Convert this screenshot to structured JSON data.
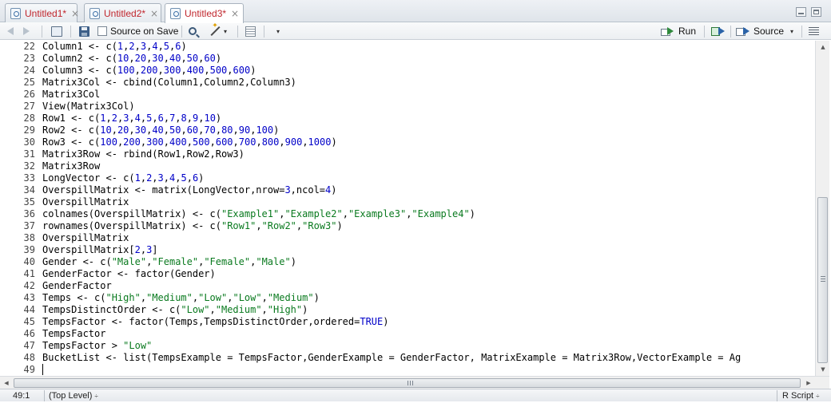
{
  "tabs": [
    {
      "label": "Untitled1*",
      "close": "×",
      "active": false
    },
    {
      "label": "Untitled2*",
      "close": "×",
      "active": false
    },
    {
      "label": "Untitled3*",
      "close": "×",
      "active": true
    }
  ],
  "toolbar": {
    "source_on_save": "Source on Save",
    "run_label": "Run",
    "source_label": "Source",
    "dropdown_glyph": "▾"
  },
  "editor": {
    "lines": [
      {
        "num": "22",
        "tokens": [
          [
            "k",
            "Column1 <- c("
          ],
          [
            "n",
            "1"
          ],
          [
            "k",
            ","
          ],
          [
            "n",
            "2"
          ],
          [
            "k",
            ","
          ],
          [
            "n",
            "3"
          ],
          [
            "k",
            ","
          ],
          [
            "n",
            "4"
          ],
          [
            "k",
            ","
          ],
          [
            "n",
            "5"
          ],
          [
            "k",
            ","
          ],
          [
            "n",
            "6"
          ],
          [
            "k",
            ")"
          ]
        ]
      },
      {
        "num": "23",
        "tokens": [
          [
            "k",
            "Column2 <- c("
          ],
          [
            "n",
            "10"
          ],
          [
            "k",
            ","
          ],
          [
            "n",
            "20"
          ],
          [
            "k",
            ","
          ],
          [
            "n",
            "30"
          ],
          [
            "k",
            ","
          ],
          [
            "n",
            "40"
          ],
          [
            "k",
            ","
          ],
          [
            "n",
            "50"
          ],
          [
            "k",
            ","
          ],
          [
            "n",
            "60"
          ],
          [
            "k",
            ")"
          ]
        ]
      },
      {
        "num": "24",
        "tokens": [
          [
            "k",
            "Column3 <- c("
          ],
          [
            "n",
            "100"
          ],
          [
            "k",
            ","
          ],
          [
            "n",
            "200"
          ],
          [
            "k",
            ","
          ],
          [
            "n",
            "300"
          ],
          [
            "k",
            ","
          ],
          [
            "n",
            "400"
          ],
          [
            "k",
            ","
          ],
          [
            "n",
            "500"
          ],
          [
            "k",
            ","
          ],
          [
            "n",
            "600"
          ],
          [
            "k",
            ")"
          ]
        ]
      },
      {
        "num": "25",
        "tokens": [
          [
            "k",
            "Matrix3Col <- cbind(Column1,Column2,Column3)"
          ]
        ]
      },
      {
        "num": "26",
        "tokens": [
          [
            "k",
            "Matrix3Col"
          ]
        ]
      },
      {
        "num": "27",
        "tokens": [
          [
            "k",
            "View(Matrix3Col)"
          ]
        ]
      },
      {
        "num": "28",
        "tokens": [
          [
            "k",
            "Row1 <- c("
          ],
          [
            "n",
            "1"
          ],
          [
            "k",
            ","
          ],
          [
            "n",
            "2"
          ],
          [
            "k",
            ","
          ],
          [
            "n",
            "3"
          ],
          [
            "k",
            ","
          ],
          [
            "n",
            "4"
          ],
          [
            "k",
            ","
          ],
          [
            "n",
            "5"
          ],
          [
            "k",
            ","
          ],
          [
            "n",
            "6"
          ],
          [
            "k",
            ","
          ],
          [
            "n",
            "7"
          ],
          [
            "k",
            ","
          ],
          [
            "n",
            "8"
          ],
          [
            "k",
            ","
          ],
          [
            "n",
            "9"
          ],
          [
            "k",
            ","
          ],
          [
            "n",
            "10"
          ],
          [
            "k",
            ")"
          ]
        ]
      },
      {
        "num": "29",
        "tokens": [
          [
            "k",
            "Row2 <- c("
          ],
          [
            "n",
            "10"
          ],
          [
            "k",
            ","
          ],
          [
            "n",
            "20"
          ],
          [
            "k",
            ","
          ],
          [
            "n",
            "30"
          ],
          [
            "k",
            ","
          ],
          [
            "n",
            "40"
          ],
          [
            "k",
            ","
          ],
          [
            "n",
            "50"
          ],
          [
            "k",
            ","
          ],
          [
            "n",
            "60"
          ],
          [
            "k",
            ","
          ],
          [
            "n",
            "70"
          ],
          [
            "k",
            ","
          ],
          [
            "n",
            "80"
          ],
          [
            "k",
            ","
          ],
          [
            "n",
            "90"
          ],
          [
            "k",
            ","
          ],
          [
            "n",
            "100"
          ],
          [
            "k",
            ")"
          ]
        ]
      },
      {
        "num": "30",
        "tokens": [
          [
            "k",
            "Row3 <- c("
          ],
          [
            "n",
            "100"
          ],
          [
            "k",
            ","
          ],
          [
            "n",
            "200"
          ],
          [
            "k",
            ","
          ],
          [
            "n",
            "300"
          ],
          [
            "k",
            ","
          ],
          [
            "n",
            "400"
          ],
          [
            "k",
            ","
          ],
          [
            "n",
            "500"
          ],
          [
            "k",
            ","
          ],
          [
            "n",
            "600"
          ],
          [
            "k",
            ","
          ],
          [
            "n",
            "700"
          ],
          [
            "k",
            ","
          ],
          [
            "n",
            "800"
          ],
          [
            "k",
            ","
          ],
          [
            "n",
            "900"
          ],
          [
            "k",
            ","
          ],
          [
            "n",
            "1000"
          ],
          [
            "k",
            ")"
          ]
        ]
      },
      {
        "num": "31",
        "tokens": [
          [
            "k",
            "Matrix3Row <- rbind(Row1,Row2,Row3)"
          ]
        ]
      },
      {
        "num": "32",
        "tokens": [
          [
            "k",
            "Matrix3Row"
          ]
        ]
      },
      {
        "num": "33",
        "tokens": [
          [
            "k",
            "LongVector <- c("
          ],
          [
            "n",
            "1"
          ],
          [
            "k",
            ","
          ],
          [
            "n",
            "2"
          ],
          [
            "k",
            ","
          ],
          [
            "n",
            "3"
          ],
          [
            "k",
            ","
          ],
          [
            "n",
            "4"
          ],
          [
            "k",
            ","
          ],
          [
            "n",
            "5"
          ],
          [
            "k",
            ","
          ],
          [
            "n",
            "6"
          ],
          [
            "k",
            ")"
          ]
        ]
      },
      {
        "num": "34",
        "tokens": [
          [
            "k",
            "OverspillMatrix <- matrix(LongVector,nrow="
          ],
          [
            "n",
            "3"
          ],
          [
            "k",
            ",ncol="
          ],
          [
            "n",
            "4"
          ],
          [
            "k",
            ")"
          ]
        ]
      },
      {
        "num": "35",
        "tokens": [
          [
            "k",
            "OverspillMatrix"
          ]
        ]
      },
      {
        "num": "36",
        "tokens": [
          [
            "k",
            "colnames(OverspillMatrix) <- c("
          ],
          [
            "s",
            "\"Example1\""
          ],
          [
            "k",
            ","
          ],
          [
            "s",
            "\"Example2\""
          ],
          [
            "k",
            ","
          ],
          [
            "s",
            "\"Example3\""
          ],
          [
            "k",
            ","
          ],
          [
            "s",
            "\"Example4\""
          ],
          [
            "k",
            ")"
          ]
        ]
      },
      {
        "num": "37",
        "tokens": [
          [
            "k",
            "rownames(OverspillMatrix) <- c("
          ],
          [
            "s",
            "\"Row1\""
          ],
          [
            "k",
            ","
          ],
          [
            "s",
            "\"Row2\""
          ],
          [
            "k",
            ","
          ],
          [
            "s",
            "\"Row3\""
          ],
          [
            "k",
            ")"
          ]
        ]
      },
      {
        "num": "38",
        "tokens": [
          [
            "k",
            "OverspillMatrix"
          ]
        ]
      },
      {
        "num": "39",
        "tokens": [
          [
            "k",
            "OverspillMatrix["
          ],
          [
            "n",
            "2"
          ],
          [
            "k",
            ","
          ],
          [
            "n",
            "3"
          ],
          [
            "k",
            "]"
          ]
        ]
      },
      {
        "num": "40",
        "tokens": [
          [
            "k",
            "Gender <- c("
          ],
          [
            "s",
            "\"Male\""
          ],
          [
            "k",
            ","
          ],
          [
            "s",
            "\"Female\""
          ],
          [
            "k",
            ","
          ],
          [
            "s",
            "\"Female\""
          ],
          [
            "k",
            ","
          ],
          [
            "s",
            "\"Male\""
          ],
          [
            "k",
            ")"
          ]
        ]
      },
      {
        "num": "41",
        "tokens": [
          [
            "k",
            "GenderFactor <- factor(Gender)"
          ]
        ]
      },
      {
        "num": "42",
        "tokens": [
          [
            "k",
            "GenderFactor"
          ]
        ]
      },
      {
        "num": "43",
        "tokens": [
          [
            "k",
            "Temps <- c("
          ],
          [
            "s",
            "\"High\""
          ],
          [
            "k",
            ","
          ],
          [
            "s",
            "\"Medium\""
          ],
          [
            "k",
            ","
          ],
          [
            "s",
            "\"Low\""
          ],
          [
            "k",
            ","
          ],
          [
            "s",
            "\"Low\""
          ],
          [
            "k",
            ","
          ],
          [
            "s",
            "\"Medium\""
          ],
          [
            "k",
            ")"
          ]
        ]
      },
      {
        "num": "44",
        "tokens": [
          [
            "k",
            "TempsDistinctOrder <- c("
          ],
          [
            "s",
            "\"Low\""
          ],
          [
            "k",
            ","
          ],
          [
            "s",
            "\"Medium\""
          ],
          [
            "k",
            ","
          ],
          [
            "s",
            "\"High\""
          ],
          [
            "k",
            ")"
          ]
        ]
      },
      {
        "num": "45",
        "tokens": [
          [
            "k",
            "TempsFactor <- factor(Temps,TempsDistinctOrder,ordered="
          ],
          [
            "n",
            "TRUE"
          ],
          [
            "k",
            ")"
          ]
        ]
      },
      {
        "num": "46",
        "tokens": [
          [
            "k",
            "TempsFactor"
          ]
        ]
      },
      {
        "num": "47",
        "tokens": [
          [
            "k",
            "TempsFactor > "
          ],
          [
            "s",
            "\"Low\""
          ]
        ]
      },
      {
        "num": "48",
        "tokens": [
          [
            "k",
            "BucketList <- list(TempsExample = TempsFactor,GenderExample = GenderFactor, MatrixExample = Matrix3Row,VectorExample = Ag"
          ]
        ]
      },
      {
        "num": "49",
        "tokens": []
      }
    ]
  },
  "statusbar": {
    "position": "49:1",
    "scope": "(Top Level)",
    "filetype": "R Script",
    "updown_glyph": "÷"
  },
  "colors": {
    "tab_label": "#c0262d",
    "number": "#0000c8",
    "string": "#0a7a1f"
  }
}
